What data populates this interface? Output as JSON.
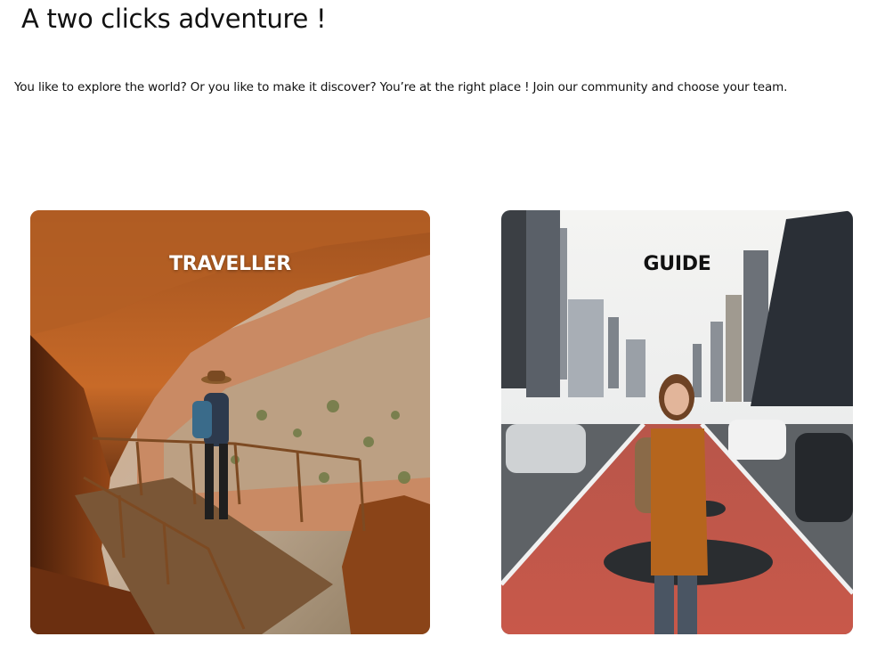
{
  "page": {
    "title": "A two clicks adventure !",
    "intro": "You like to explore the world? Or you like to make it discover? You’re at the right place ! Join our community and choose your team."
  },
  "cards": [
    {
      "label": "TRAVELLER",
      "scene": "hiker-in-canyon-photo"
    },
    {
      "label": "GUIDE",
      "scene": "woman-in-city-street-photo"
    }
  ],
  "colors": {
    "background": "#ffffff",
    "text": "#111111",
    "traveller_label": "#ffffff",
    "guide_label": "#111111"
  }
}
